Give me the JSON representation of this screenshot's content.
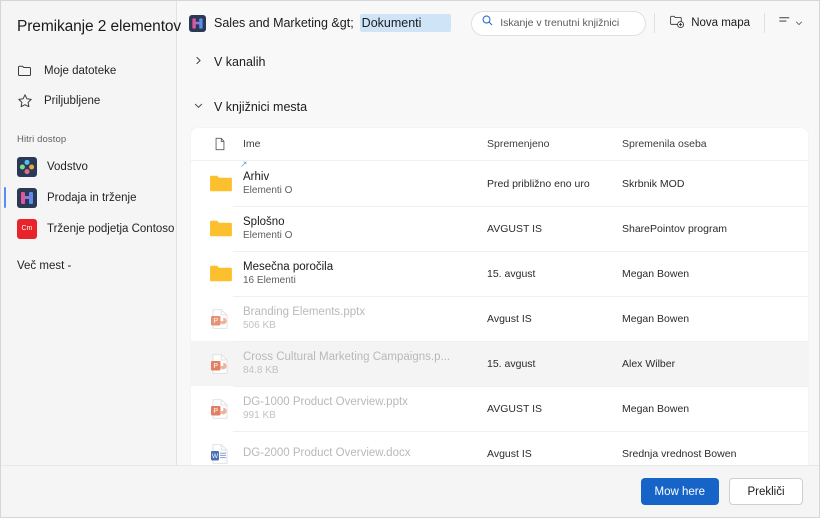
{
  "dialog": {
    "title": "Premikanje 2 elementov"
  },
  "sidebar": {
    "nav": [
      {
        "label": "Moje datoteke",
        "icon": "folder-outline-icon"
      },
      {
        "label": "Priljubljene",
        "icon": "star-outline-icon"
      }
    ],
    "quick_access_label": "Hitri dostop",
    "sites": [
      {
        "label": "Vodstvo",
        "icon": "site-leadership-icon",
        "badge_bg": "#2b3a54",
        "badge_text": "",
        "active": false
      },
      {
        "label": "Prodaja in trženje",
        "icon": "site-sales-marketing-icon",
        "badge_bg": "#2b3a54",
        "badge_text": "",
        "active": true
      },
      {
        "label": "Trženje podjetja Contoso",
        "icon": "site-contoso-marketing-icon",
        "badge_bg": "#e8232a",
        "badge_text": "Cm",
        "active": false
      }
    ],
    "more_places_label": "Več mest -"
  },
  "toolbar": {
    "breadcrumb_root": "Sales and Marketing &gt;",
    "breadcrumb_current": "Dokumenti",
    "search_placeholder": "Iskanje v trenutni knjižnici",
    "new_folder_label": "Nova mapa",
    "view_menu_label": ""
  },
  "sections": [
    {
      "label": "V kanalih",
      "expanded": false
    },
    {
      "label": "V knjižnici mesta",
      "expanded": true
    }
  ],
  "file_list": {
    "columns": {
      "icon": "",
      "name": "Ime",
      "modified": "Spremenjeno",
      "modified_by": "Spremenila oseba"
    },
    "rows": [
      {
        "name": "Arhiv",
        "sub": "Elementi O",
        "modified": "Pred približno eno uro",
        "modified_by": "Skrbnik MOD",
        "icon": "folder-icon",
        "dimmed": false,
        "hover": false,
        "shortcut": true
      },
      {
        "name": "Splošno",
        "sub": "Elementi O",
        "modified": "AVGUST IS",
        "modified_by": "SharePointov program",
        "icon": "folder-icon",
        "dimmed": false,
        "hover": false,
        "shortcut": false
      },
      {
        "name": "Mesečna poročila",
        "sub": "16 Elementi",
        "modified": "15. avgust",
        "modified_by": "Megan Bowen",
        "icon": "folder-icon",
        "dimmed": false,
        "hover": false,
        "shortcut": false
      },
      {
        "name": "Branding Elements.pptx",
        "sub": "506 KB",
        "modified": "Avgust   IS",
        "modified_by": "Megan Bowen",
        "icon": "powerpoint-icon",
        "dimmed": true,
        "hover": false,
        "shortcut": false
      },
      {
        "name": "Cross Cultural Marketing Campaigns.p...",
        "sub": "84.8 KB",
        "modified": "15. avgust",
        "modified_by": "Alex Wilber",
        "icon": "powerpoint-icon",
        "dimmed": true,
        "hover": true,
        "shortcut": false
      },
      {
        "name": "DG-1000 Product Overview.pptx",
        "sub": "991 KB",
        "modified": "AVGUST IS",
        "modified_by": "Megan Bowen",
        "icon": "powerpoint-icon",
        "dimmed": true,
        "hover": false,
        "shortcut": false
      },
      {
        "name": "DG-2000 Product Overview.docx",
        "sub": "",
        "modified": "Avgust   IS",
        "modified_by": "Srednja vrednost Bowen",
        "icon": "word-icon",
        "dimmed": true,
        "hover": false,
        "shortcut": false
      }
    ]
  },
  "footer": {
    "primary_label": "Mow here",
    "secondary_label": "Prekliči"
  },
  "colors": {
    "accent": "#1664c8",
    "active_indicator": "#5b8def",
    "folder": "#fcc02e",
    "powerpoint": "#d35230",
    "word": "#2b579a",
    "selection_highlight": "#cfe4f7"
  }
}
